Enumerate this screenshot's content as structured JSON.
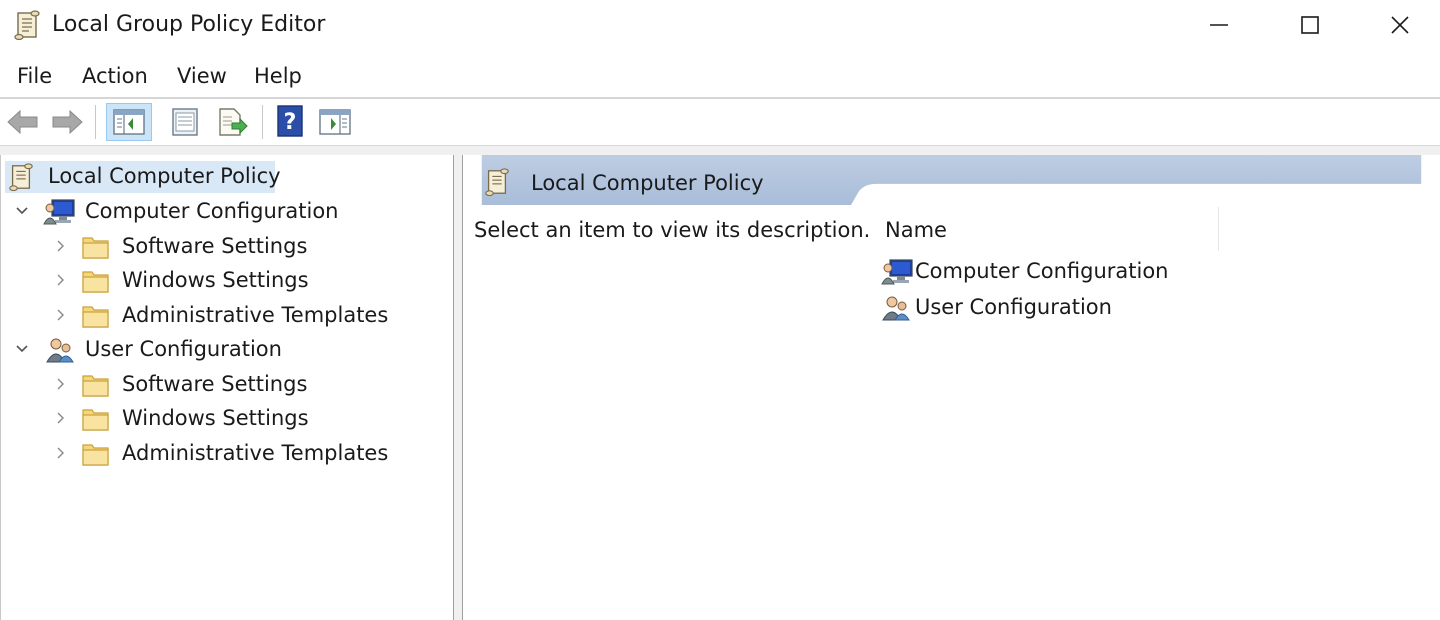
{
  "window": {
    "title": "Local Group Policy Editor",
    "app_icon": "policy-scroll-icon",
    "controls": {
      "minimize": "minimize-icon",
      "maximize": "maximize-icon",
      "close": "close-icon"
    }
  },
  "menu": [
    "File",
    "Action",
    "View",
    "Help"
  ],
  "toolbar": {
    "buttons": [
      "back-arrow-icon",
      "forward-arrow-icon",
      "show-hide-console-tree-icon",
      "properties-icon",
      "export-list-icon",
      "help-icon",
      "show-hide-action-pane-icon"
    ]
  },
  "tree": {
    "root": "Local Computer Policy",
    "nodes": [
      {
        "label": "Computer Configuration",
        "icon": "computer-config-icon",
        "children": [
          "Software Settings",
          "Windows Settings",
          "Administrative Templates"
        ]
      },
      {
        "label": "User Configuration",
        "icon": "user-config-icon",
        "children": [
          "Software Settings",
          "Windows Settings",
          "Administrative Templates"
        ]
      }
    ]
  },
  "details": {
    "header": "Local Computer Policy",
    "description": "Select an item to view its description.",
    "column_name": "Name",
    "items": [
      "Computer Configuration",
      "User Configuration"
    ]
  },
  "colors": {
    "header_band": "#a9bdd9",
    "selection": "#d9e8f7",
    "folder": "#f5d77a"
  }
}
